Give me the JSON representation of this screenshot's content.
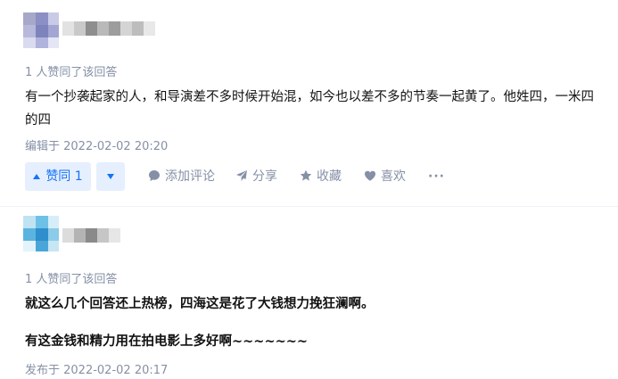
{
  "answers": [
    {
      "upvote_info": "1 人赞同了该回答",
      "paragraphs": [
        "有一个抄袭起家的人，和导演差不多时候开始混，如今也以差不多的节奏一起黄了。他姓四，一米四的四"
      ],
      "time": "编辑于 2022-02-02 20:20",
      "actions": {
        "upvote_label": "赞同 1",
        "comment_label": "添加评论",
        "share_label": "分享",
        "favorite_label": "收藏",
        "like_label": "喜欢",
        "more_label": "···"
      }
    },
    {
      "upvote_info": "1 人赞同了该回答",
      "paragraphs": [
        "就这么几个回答还上热榜，四海这是花了大钱想力挽狂澜啊。",
        "有这金钱和精力用在拍电影上多好啊~~~~~~~"
      ],
      "time": "发布于 2022-02-02 20:17"
    }
  ],
  "colors": {
    "meta": "#8590a6",
    "accent": "#1772f6",
    "accent_bg": "#e5effe",
    "text": "#121212"
  },
  "icons": [
    "comment-icon",
    "share-icon",
    "star-icon",
    "heart-icon"
  ]
}
